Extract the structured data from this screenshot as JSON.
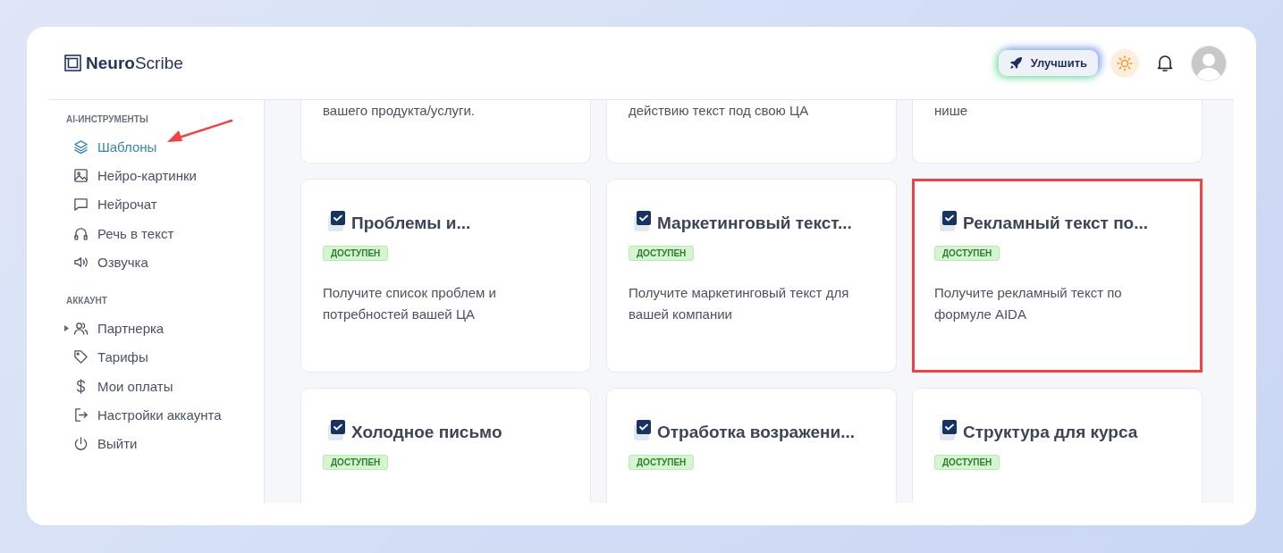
{
  "logo": {
    "bold": "Neuro",
    "light": "Scribe"
  },
  "header": {
    "upgrade_button": "Улучшить"
  },
  "sidebar": {
    "sections": [
      {
        "title": "AI-ИНСТРУМЕНТЫ",
        "items": [
          {
            "label": "Шаблоны",
            "kind": "layers",
            "selected": true
          },
          {
            "label": "Нейро-картинки",
            "kind": "image",
            "selected": false
          },
          {
            "label": "Нейрочат",
            "kind": "chat",
            "selected": false
          },
          {
            "label": "Речь в текст",
            "kind": "headphones",
            "selected": false
          },
          {
            "label": "Озвучка",
            "kind": "speaker",
            "selected": false
          }
        ]
      },
      {
        "title": "АККАУНТ",
        "items": [
          {
            "label": "Партнерка",
            "kind": "users",
            "selected": false,
            "expanded": false
          },
          {
            "label": "Тарифы",
            "kind": "tag",
            "selected": false
          },
          {
            "label": "Мои оплаты",
            "kind": "dollar",
            "selected": false
          },
          {
            "label": "Настройки аккаунта",
            "kind": "logout",
            "selected": false
          },
          {
            "label": "Выйти",
            "kind": "power",
            "selected": false
          }
        ]
      }
    ]
  },
  "cards": [
    {
      "kind": "tail",
      "description": "вашего продукта/услуги.",
      "highlighted": false
    },
    {
      "kind": "tail",
      "description": "действию текст под свою ЦА",
      "highlighted": false
    },
    {
      "kind": "tail",
      "description": "нише",
      "highlighted": false
    },
    {
      "kind": "full",
      "title": "Проблемы и...",
      "badge": "ДОСТУПЕН",
      "description": "Получите список проблем и потребностей вашей ЦА",
      "highlighted": false
    },
    {
      "kind": "full",
      "title": "Маркетинговый текст...",
      "badge": "ДОСТУПЕН",
      "description": "Получите маркетинговый текст для вашей компании",
      "highlighted": false
    },
    {
      "kind": "full",
      "title": "Рекламный текст по...",
      "badge": "ДОСТУПЕН",
      "description": "Получите рекламный текст по формуле AIDA",
      "highlighted": true
    },
    {
      "kind": "full",
      "title": "Холодное письмо",
      "badge": "ДОСТУПЕН",
      "highlighted": false
    },
    {
      "kind": "full",
      "title": "Отработка возражени...",
      "badge": "ДОСТУПЕН",
      "highlighted": false
    },
    {
      "kind": "full",
      "title": "Структура для курса",
      "badge": "ДОСТУПЕН",
      "highlighted": false
    }
  ]
}
